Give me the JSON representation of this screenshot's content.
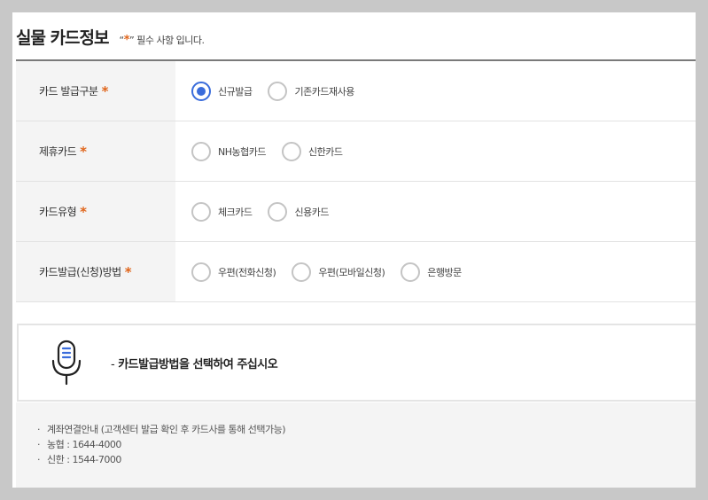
{
  "header": {
    "title": "실물 카드정보",
    "req_prefix": "“",
    "req_star": "*",
    "req_suffix": "” 필수 사항 입니다."
  },
  "form": {
    "required_mark": "*",
    "rows": [
      {
        "label": "카드 발급구분",
        "options": [
          {
            "label": "신규발급",
            "checked": true
          },
          {
            "label": "기존카드재사용",
            "checked": false
          }
        ]
      },
      {
        "label": "제휴카드",
        "options": [
          {
            "label": "NH농협카드",
            "checked": false
          },
          {
            "label": "신한카드",
            "checked": false
          }
        ]
      },
      {
        "label": "카드유형",
        "options": [
          {
            "label": "체크카드",
            "checked": false
          },
          {
            "label": "신용카드",
            "checked": false
          }
        ]
      },
      {
        "label": "카드발급(신청)방법",
        "options": [
          {
            "label": "우편(전화신청)",
            "checked": false
          },
          {
            "label": "우편(모바일신청)",
            "checked": false
          },
          {
            "label": "은행방문",
            "checked": false
          }
        ]
      }
    ]
  },
  "notice": {
    "icon": "microphone-icon",
    "dash": "-",
    "text": "카드발급방법을 선택하여 주십시오"
  },
  "info": {
    "bullet": "·",
    "lines": [
      "계좌연결안내 (고객센터 발급 확인 후 카드사를 통해 선택가능)",
      "농협 : 1644-4000",
      "신한 : 1544-7000"
    ]
  },
  "colors": {
    "accent": "#3a6cdb",
    "required": "#e0651b",
    "label_bg": "#f4f4f4"
  }
}
